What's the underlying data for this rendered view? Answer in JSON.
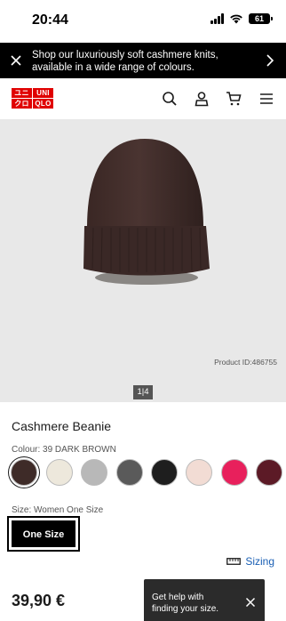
{
  "status_bar": {
    "time": "20:44",
    "battery": "61"
  },
  "promo_banner": {
    "text": "Shop our luxuriously soft cashmere knits, available in a wide range of colours."
  },
  "header": {
    "logo": [
      "ユニ",
      "UNI",
      "クロ",
      "QLO"
    ]
  },
  "product": {
    "product_id": "Product ID:486755",
    "image_counter": "1|4",
    "title": "Cashmere Beanie",
    "colour_label": "Colour: 39 DARK BROWN",
    "swatch_colors": [
      "#3e2b28",
      "#ede8dc",
      "#b8b8b8",
      "#5a5a5a",
      "#1e1e1e",
      "#f2dcd4",
      "#e8205c",
      "#5c1a26"
    ],
    "size_label": "Size: Women One Size",
    "size_option": "One Size",
    "sizing_link": "Sizing",
    "price": "39,90 €"
  },
  "help_popup": {
    "text": "Get help with finding your size."
  },
  "colors": {
    "brand_red": "#e00000",
    "link_blue": "#1a5fb4",
    "beanie_brown": "#3f2a27"
  }
}
